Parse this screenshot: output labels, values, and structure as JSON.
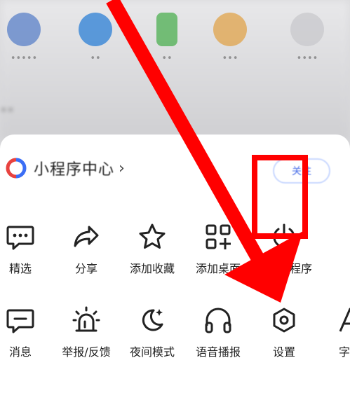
{
  "background": {
    "apps": [
      {
        "label": "•••••",
        "color": "#5a80c8"
      },
      {
        "label": "••",
        "color": "#2b7fd6"
      },
      {
        "label": "••",
        "color": "#4caf50"
      },
      {
        "label": "•••",
        "color": "#e0a34a"
      },
      {
        "label": "••••",
        "color": "#c8c8cc"
      }
    ],
    "tab": "••"
  },
  "mini_program": {
    "title": "小程序中心",
    "chevron": "›",
    "follow_label": "关注"
  },
  "actions_row1": [
    {
      "label": "精选",
      "icon": "chat-bubble-icon"
    },
    {
      "label": "分享",
      "icon": "share-arrow-icon"
    },
    {
      "label": "添加收藏",
      "icon": "star-icon"
    },
    {
      "label": "添加桌面",
      "icon": "grid-add-icon"
    },
    {
      "label": "退出小程序",
      "icon": "power-icon"
    }
  ],
  "actions_row2": [
    {
      "label": "消息",
      "icon": "message-icon"
    },
    {
      "label": "举报/反馈",
      "icon": "alarm-icon"
    },
    {
      "label": "夜间模式",
      "icon": "moon-icon"
    },
    {
      "label": "语音播报",
      "icon": "headphones-icon"
    },
    {
      "label": "设置",
      "icon": "settings-hexagon-icon"
    },
    {
      "label": "字体",
      "icon": "font-icon"
    }
  ],
  "colors": {
    "highlight": "#ff0000",
    "accent": "#4a6fe8"
  }
}
